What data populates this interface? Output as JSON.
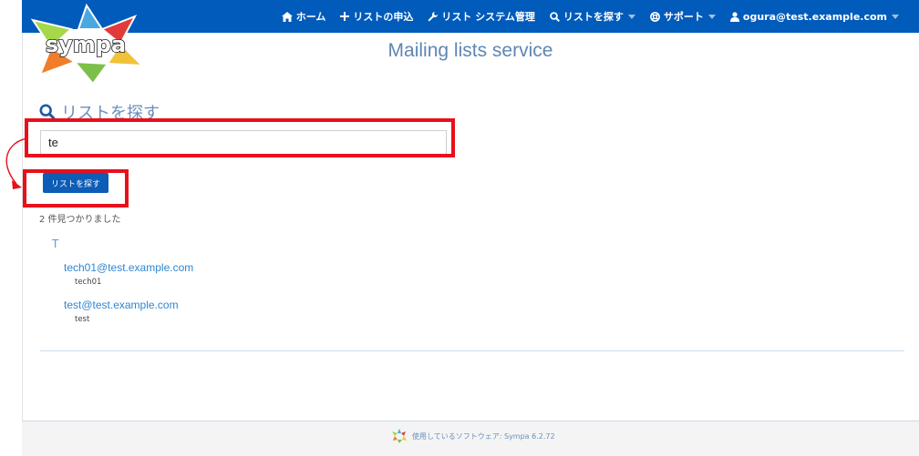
{
  "nav": {
    "home": "ホーム",
    "request_list": "リストの申込",
    "admin": "リスト システム管理",
    "search_lists": "リストを探す",
    "support": "サポート",
    "user": "ogura@test.example.com"
  },
  "logo": {
    "text": "sympa"
  },
  "site_title": "Mailing lists service",
  "search": {
    "heading": "リストを探す",
    "input_value": "te",
    "button_label": "リストを探す"
  },
  "results": {
    "count_text": "2 件見つかりました",
    "group_letter": "T",
    "items": [
      {
        "address": "tech01@test.example.com",
        "description": "tech01"
      },
      {
        "address": "test@test.example.com",
        "description": "test"
      }
    ]
  },
  "footer": {
    "text": "使用しているソフトウェア: Sympa 6.2.72"
  },
  "colors": {
    "topbar": "#005bbb",
    "highlight": "#e8101b",
    "link": "#2f86d1"
  },
  "icons": [
    "home-icon",
    "plus-icon",
    "wrench-icon",
    "search-icon",
    "support-icon",
    "user-icon",
    "caret-down-icon"
  ]
}
